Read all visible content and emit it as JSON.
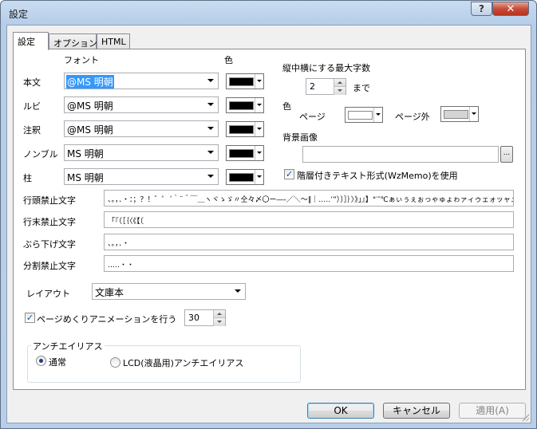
{
  "window": {
    "title": "設定",
    "help": "?",
    "close": "✕"
  },
  "tabs": [
    {
      "label": "設定"
    },
    {
      "label": "オプション"
    },
    {
      "label": "HTML"
    }
  ],
  "headers": {
    "font": "フォント",
    "color": "色"
  },
  "rows": [
    {
      "label": "本文",
      "font": "@MS 明朝",
      "color": "#000000"
    },
    {
      "label": "ルビ",
      "font": "@MS 明朝",
      "color": "#000000"
    },
    {
      "label": "注釈",
      "font": "@MS 明朝",
      "color": "#000000"
    },
    {
      "label": "ノンブル",
      "font": "MS 明朝",
      "color": "#000000"
    },
    {
      "label": "柱",
      "font": "MS 明朝",
      "color": "#000000"
    }
  ],
  "tatechuyoko": {
    "label": "縦中横にする最大字数",
    "value": "2",
    "suffix": "まで"
  },
  "page_color": {
    "label": "色",
    "page_label": "ページ",
    "page_color": "#ffffff",
    "outside_label": "ページ外",
    "outside_color": "#d4d4d4"
  },
  "background": {
    "label": "背景画像",
    "value": "",
    "browse": "..."
  },
  "layered_text": {
    "label": "階層付きテキスト形式(WzMemo)を使用",
    "checked": true
  },
  "kinsoku": [
    {
      "label": "行頭禁止文字",
      "value": "、。，．・：；？！゛゜´｀¨＾￣＿ヽヾゝゞ〃仝々〆〇ー―‐／＼～∥｜…‥’”）〕］｝〉》」』】°′″℃ぁぃぅぇぉっゃゅょゎァィゥェォッャュョヮヵヶ"
    },
    {
      "label": "行末禁止文字",
      "value": "「『（［｛〈《【〔"
    },
    {
      "label": "ぶら下げ文字",
      "value": "、。，．・"
    },
    {
      "label": "分割禁止文字",
      "value": "‥…・・"
    }
  ],
  "layout": {
    "label": "レイアウト",
    "value": "文庫本"
  },
  "animation": {
    "label": "ページめくりアニメーションを行う",
    "checked": true,
    "value": "30"
  },
  "antialias": {
    "title": "アンチエイリアス",
    "options": [
      {
        "label": "通常",
        "selected": true
      },
      {
        "label": "LCD(液晶用)アンチエイリアス",
        "selected": false
      }
    ]
  },
  "buttons": {
    "ok": "OK",
    "cancel": "キャンセル",
    "apply": "適用(A)"
  }
}
